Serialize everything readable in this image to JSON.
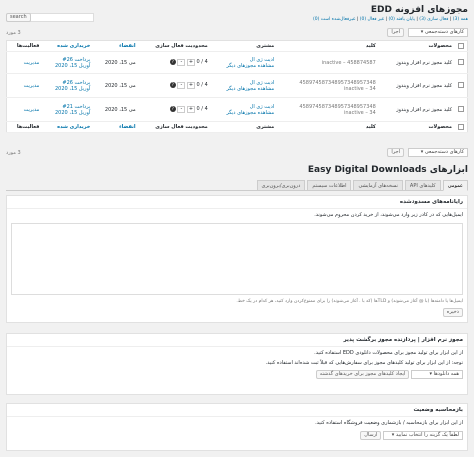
{
  "page": {
    "title": "مجوزهای افزونه EDD",
    "filters": [
      {
        "label": "همه",
        "count": "(3)"
      },
      {
        "label": "فعال سازی",
        "count": "(3)"
      },
      {
        "label": "پایان یافته",
        "count": "(0)"
      },
      {
        "label": "غیر فعال",
        "count": "(0)"
      },
      {
        "label": "غیرفعال‌شده است",
        "count": "(0)"
      }
    ],
    "search_button": "search",
    "bulk_select": "کارهای دسته‌جمعی",
    "apply_button": "اجرا",
    "items_count": "3 مورد",
    "columns": [
      "محصولات",
      "کلید",
      "مشتری",
      "محدودیت فعال سازی",
      "انقضاء",
      "خریداری شده",
      "فعالیت‌ها"
    ],
    "rows": [
      {
        "product": "کلید مجوز نرم افزار ویندوز",
        "key": "inactive – 458874587",
        "customer": "ادیت ژی ال",
        "customer_link": "مشاهده مجوزهای دیگر",
        "activations": "4 / 0",
        "expires": "می 15، 2020",
        "purchased": "پرداخت 26#",
        "purchased_date": "آوریل 15، 2020",
        "action": "مدیریت"
      },
      {
        "product": "کلید مجوز نرم افزار ویندوز",
        "key": "458974587348957348957348",
        "key2": "inactive – 34",
        "customer": "ادیت ژی ال",
        "customer_link": "مشاهده مجوزهای دیگر",
        "activations": "4 / 0",
        "expires": "می 15، 2020",
        "purchased": "پرداخت 26#",
        "purchased_date": "آوریل 15، 2020",
        "action": "مدیریت"
      },
      {
        "product": "کلید مجوز نرم افزار ویندوز",
        "key": "458974587348957348957348",
        "key2": "inactive – 34",
        "customer": "ادیت ژی ال",
        "customer_link": "مشاهده مجوزهای دیگر",
        "activations": "4 / 0",
        "expires": "می 15، 2020",
        "purchased": "پرداخت 21#",
        "purchased_date": "آوریل 15، 2020",
        "action": "مدیریت"
      }
    ]
  },
  "tools": {
    "title": "ابزارهای Easy Digital Downloads",
    "tabs": [
      "عمومی",
      "کلیدهای API",
      "نسخه‌های آزمایشی",
      "اطلاعات سیستم",
      "درون‌بری/برون‌بری"
    ],
    "banned_panel": {
      "heading": "رایانامه‌های مسدودشده",
      "description": "ایمیل‌هایی که در کادر زیر وارد می‌شوند، از خرید کردن محروم می‌شوند.",
      "note": "ایمیل‌ها یا دامنه‌ها (با @ آغاز می‌شوند) و TLDها (که با . آغاز می‌شوند) را برای ممنوع‌کردن وارد کنید، هر کدام در یک خط.",
      "save_button": "ذخیره"
    },
    "license_panel": {
      "heading": "مجوز نرم افزار | پردازنده مجوز برگشت پذیر",
      "description": "از این ابزار برای تولید مجوز برای محصولات دانلودی EDD استفاده کنید.",
      "description2": "توجه: از این ابزار برای تولید کلیدهای مجوز برای سفارش‌هایی که قبلاً ثبت شده‌اند استفاده کنید.",
      "select": "همه دانلودها",
      "button": "ایجاد کلیدهای مجوز برای خریدهای گذشته"
    },
    "recount_panel": {
      "heading": "بازمحاسبه وضعیت",
      "description": "از این ابزار برای بازمحاسبه / بازشماری وضعیت فروشگاه استفاده کنید.",
      "select": "لطفاً یک گزینه را انتخاب نمایید",
      "button": "ارسال"
    }
  }
}
